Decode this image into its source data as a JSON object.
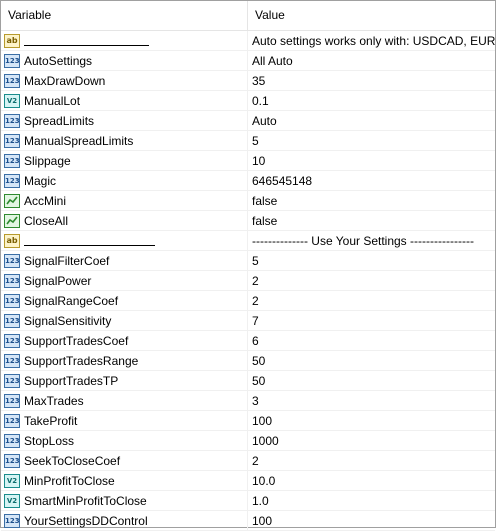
{
  "header": {
    "variable_label": "Variable",
    "value_label": "Value"
  },
  "rows": [
    {
      "type": "string",
      "name": "",
      "value": "Auto settings works only with: USDCAD, EURG..."
    },
    {
      "type": "int",
      "name": "AutoSettings",
      "value": "All Auto"
    },
    {
      "type": "int",
      "name": "MaxDrawDown",
      "value": "35"
    },
    {
      "type": "double",
      "name": "ManualLot",
      "value": "0.1"
    },
    {
      "type": "int",
      "name": "SpreadLimits",
      "value": "Auto"
    },
    {
      "type": "int",
      "name": "ManualSpreadLimits",
      "value": "5"
    },
    {
      "type": "int",
      "name": "Slippage",
      "value": "10"
    },
    {
      "type": "int",
      "name": "Magic",
      "value": "646545148"
    },
    {
      "type": "bool",
      "name": "AccMini",
      "value": "false"
    },
    {
      "type": "bool",
      "name": "CloseAll",
      "value": "false"
    },
    {
      "type": "string",
      "name": "",
      "value": "--------------  Use Your Settings  ----------------"
    },
    {
      "type": "int",
      "name": "SignalFilterCoef",
      "value": "5"
    },
    {
      "type": "int",
      "name": "SignalPower",
      "value": "2"
    },
    {
      "type": "int",
      "name": "SignalRangeCoef",
      "value": "2"
    },
    {
      "type": "int",
      "name": "SignalSensitivity",
      "value": "7"
    },
    {
      "type": "int",
      "name": "SupportTradesCoef",
      "value": "6"
    },
    {
      "type": "int",
      "name": "SupportTradesRange",
      "value": "50"
    },
    {
      "type": "int",
      "name": "SupportTradesTP",
      "value": "50"
    },
    {
      "type": "int",
      "name": "MaxTrades",
      "value": "3"
    },
    {
      "type": "int",
      "name": "TakeProfit",
      "value": "100"
    },
    {
      "type": "int",
      "name": "StopLoss",
      "value": "1000"
    },
    {
      "type": "int",
      "name": "SeekToCloseCoef",
      "value": "2"
    },
    {
      "type": "double",
      "name": "MinProfitToClose",
      "value": "10.0"
    },
    {
      "type": "double",
      "name": "SmartMinProfitToClose",
      "value": "1.0"
    },
    {
      "type": "int",
      "name": "YourSettingsDDControl",
      "value": "100"
    }
  ],
  "icon_glyphs": {
    "int": "123",
    "double": "V2",
    "string": "ab"
  }
}
